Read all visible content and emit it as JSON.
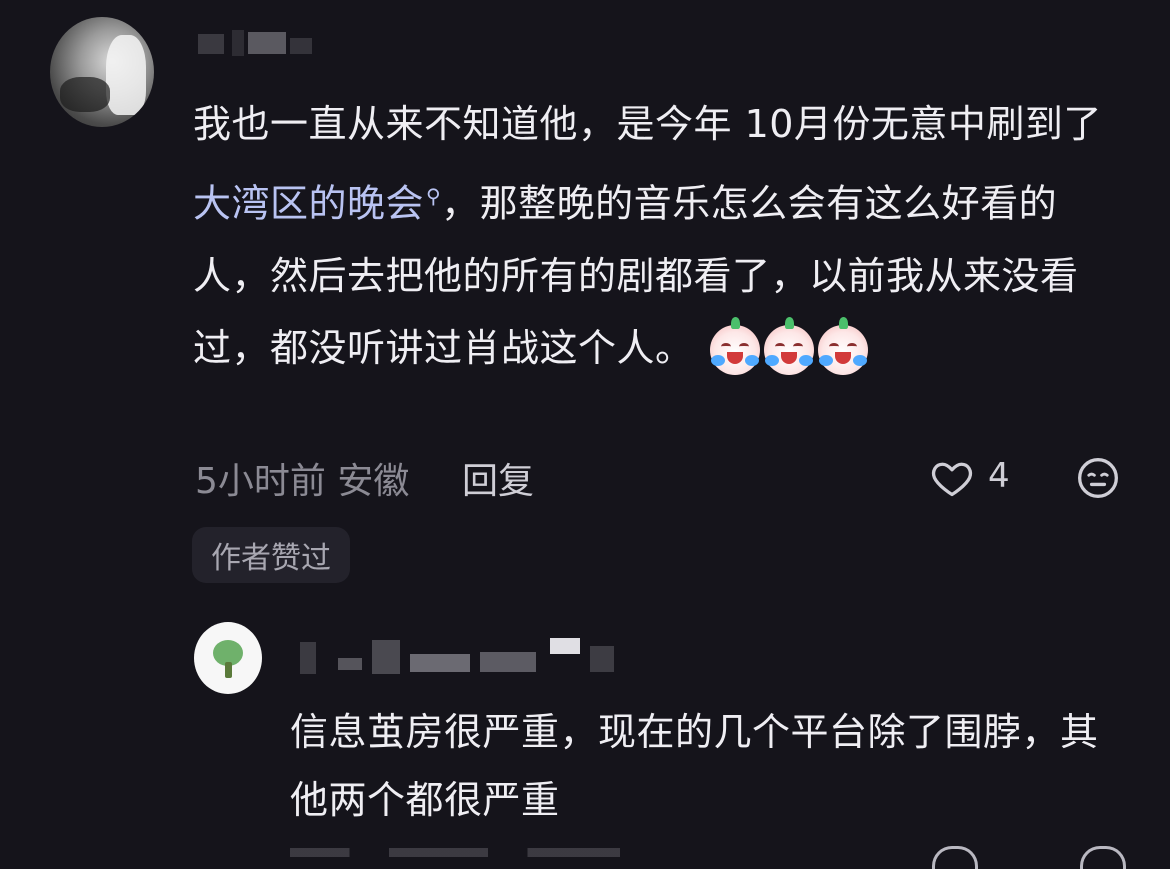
{
  "comment": {
    "text_before_link": "我也一直从来不知道他，是今年 10月份无意中刷到了 ",
    "link_text": "大湾区的晚会",
    "text_after_link": "，那整晚的音乐怎么会有这么好看的人，然后去把他的所有的剧都看了，以前我从来没看过，都没听讲过肖战这个人。",
    "emoji_names": [
      "crying-laugh-emoji",
      "crying-laugh-emoji",
      "crying-laugh-emoji"
    ],
    "meta": "5小时前 安徽",
    "reply_label": "回复",
    "like_count": "4",
    "author_badge": "作者赞过"
  },
  "reply": {
    "text": "信息茧房很严重，现在的几个平台除了围脖，其他两个都很严重"
  },
  "colors": {
    "background": "#15141b",
    "text": "#efeef3",
    "muted": "#8b8a94",
    "link": "#b9c3f2"
  }
}
